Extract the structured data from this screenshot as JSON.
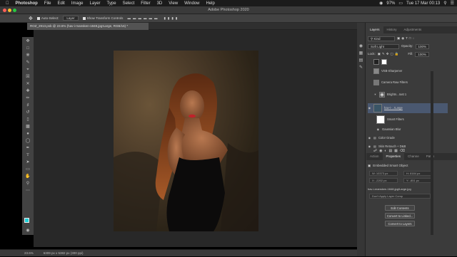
{
  "menubar": {
    "apple_icon": "apple-icon",
    "items": [
      "Photoshop",
      "File",
      "Edit",
      "Image",
      "Layer",
      "Type",
      "Select",
      "Filter",
      "3D",
      "View",
      "Window",
      "Help"
    ],
    "battery": "97%",
    "datetime": "Tue 17 Mar  00:13"
  },
  "window": {
    "title": "Adobe Photoshop 2020"
  },
  "options": {
    "auto_select": "Auto-Select:",
    "target": "Layer",
    "transform": "Show Transform Controls"
  },
  "document": {
    "tab": "ROZ_2913.psb @ 23.6% (hav-i-mansken-1848.jpg!Large, RGB/16) *"
  },
  "status": {
    "zoom": "23.6%",
    "size": "6309 px x 5382 px (300 ppi)"
  },
  "colors": {
    "foreground": "#1fd0d8",
    "background": "#ffffff"
  },
  "panels": {
    "top_tabs": [
      "Layers",
      "History",
      "Adjustments"
    ],
    "kind": "Kind",
    "blend": "Soft Light",
    "opacity_label": "Opacity:",
    "opacity": "100%",
    "lock_label": "Lock:",
    "fill_label": "Fill:",
    "fill": "100%",
    "layers": [
      {
        "name": "VSB-Sharpener"
      },
      {
        "name": "Camera Raw Filters"
      },
      {
        "name": "Brightn...rast 1"
      },
      {
        "name": "hav-i-...!Large"
      },
      {
        "name": "Smart Filters"
      },
      {
        "name": "Gaussian Blur"
      },
      {
        "name": "Color Grade"
      },
      {
        "name": "Skin Retouch + D&B"
      }
    ],
    "bottom_tabs": [
      "Action",
      "Properties",
      "Channe",
      "Paths"
    ],
    "properties": {
      "title": "Embedded Smart Object",
      "w": "W: 10373 px",
      "h": "H: 8184 px",
      "x": "X: -2202 px",
      "y": "Y: -851 px",
      "file": "hav-i-mansken-1848.jpg!Large.jpg",
      "comps": "Don't Apply Layer Comp",
      "buttons": [
        "Edit Contents",
        "Convert to Linked...",
        "Convert to Layers"
      ]
    }
  }
}
